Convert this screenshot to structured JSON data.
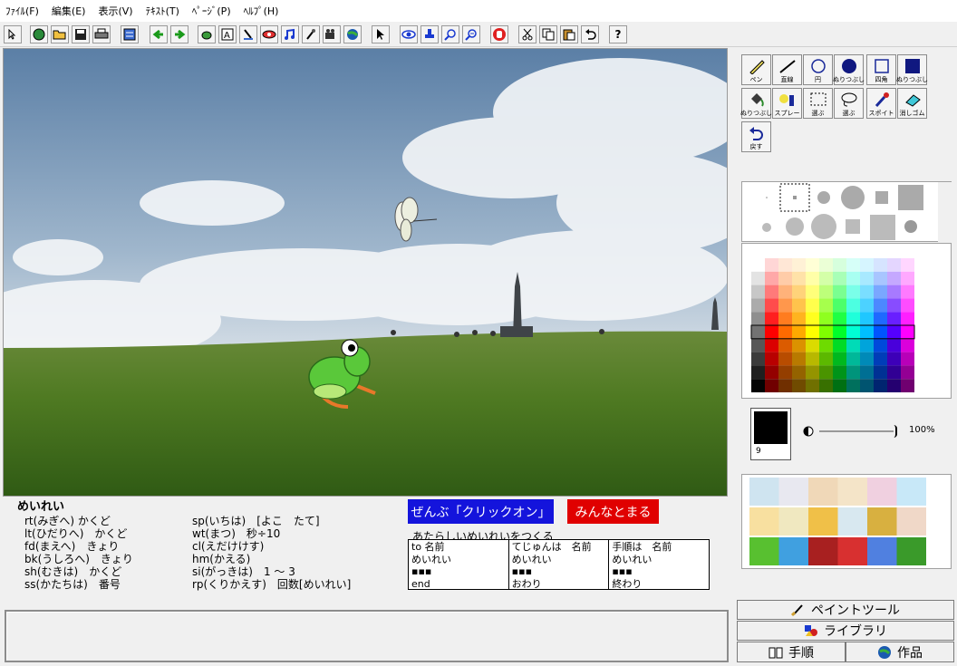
{
  "menu": [
    "ﾌｧｲﾙ(F)",
    "編集(E)",
    "表示(V)",
    "ﾃｷｽﾄ(T)",
    "ﾍﾟｰｼﾞ(P)",
    "ﾍﾙﾌﾟ(H)"
  ],
  "toolbar_help": "?",
  "commands": {
    "heading": "めいれい",
    "left": [
      "rt(みぎへ) かくど",
      "lt(ひだりへ)　かくど",
      "fd(まえへ)　きょり",
      "bk(うしろへ)　きょり",
      "sh(むきは)　かくど",
      "ss(かたちは)　番号"
    ],
    "right": [
      "sp(いちは)　[よこ　たて]",
      "wt(まつ)　秒÷10",
      "cl(えだけけす)",
      "hm(かえる)",
      "si(がっきは)　1 ～ 3",
      "rp(くりかえす)　回数[めいれい]"
    ]
  },
  "buttons": {
    "go_all": "ぜんぶ「クリックオン」",
    "stop_all": "みんなとまる"
  },
  "new_command_label": "あたらしいめいれいをつくる",
  "procedure_table": [
    [
      "to 名前",
      "めいれい",
      "▪▪▪",
      "end"
    ],
    [
      "てじゅんは　名前",
      "めいれい",
      "▪▪▪",
      "おわり"
    ],
    [
      "手順は　名前",
      "めいれい",
      "▪▪▪",
      "終わり"
    ]
  ],
  "paint_tools": [
    {
      "label": "ペン",
      "icon": "pen-icon"
    },
    {
      "label": "直線",
      "icon": "line-icon"
    },
    {
      "label": "円",
      "icon": "circle-icon"
    },
    {
      "label": "ぬりつぶし",
      "icon": "filled-circle-icon"
    },
    {
      "label": "四角",
      "icon": "rectangle-icon"
    },
    {
      "label": "ぬりつぶし",
      "icon": "filled-rectangle-icon"
    },
    {
      "label": "ぬりつぶし",
      "icon": "bucket-icon"
    },
    {
      "label": "スプレー",
      "icon": "spray-icon"
    },
    {
      "label": "選ぶ",
      "icon": "select-rect-icon"
    },
    {
      "label": "選ぶ",
      "icon": "lasso-icon"
    },
    {
      "label": "スポイト",
      "icon": "dropper-icon"
    },
    {
      "label": "消しゴム",
      "icon": "eraser-icon"
    },
    {
      "label": "戻す",
      "icon": "undo-icon"
    }
  ],
  "current_color": {
    "hex": "#000000",
    "size": "9"
  },
  "opacity": {
    "value": "100%",
    "fraction": 1.0
  },
  "tabs": {
    "paint": "ペイントツール",
    "library": "ライブラリ",
    "procedure": "手順",
    "works": "作品"
  },
  "colors": {
    "go_button": "#1414dc",
    "stop_button": "#e00000"
  }
}
